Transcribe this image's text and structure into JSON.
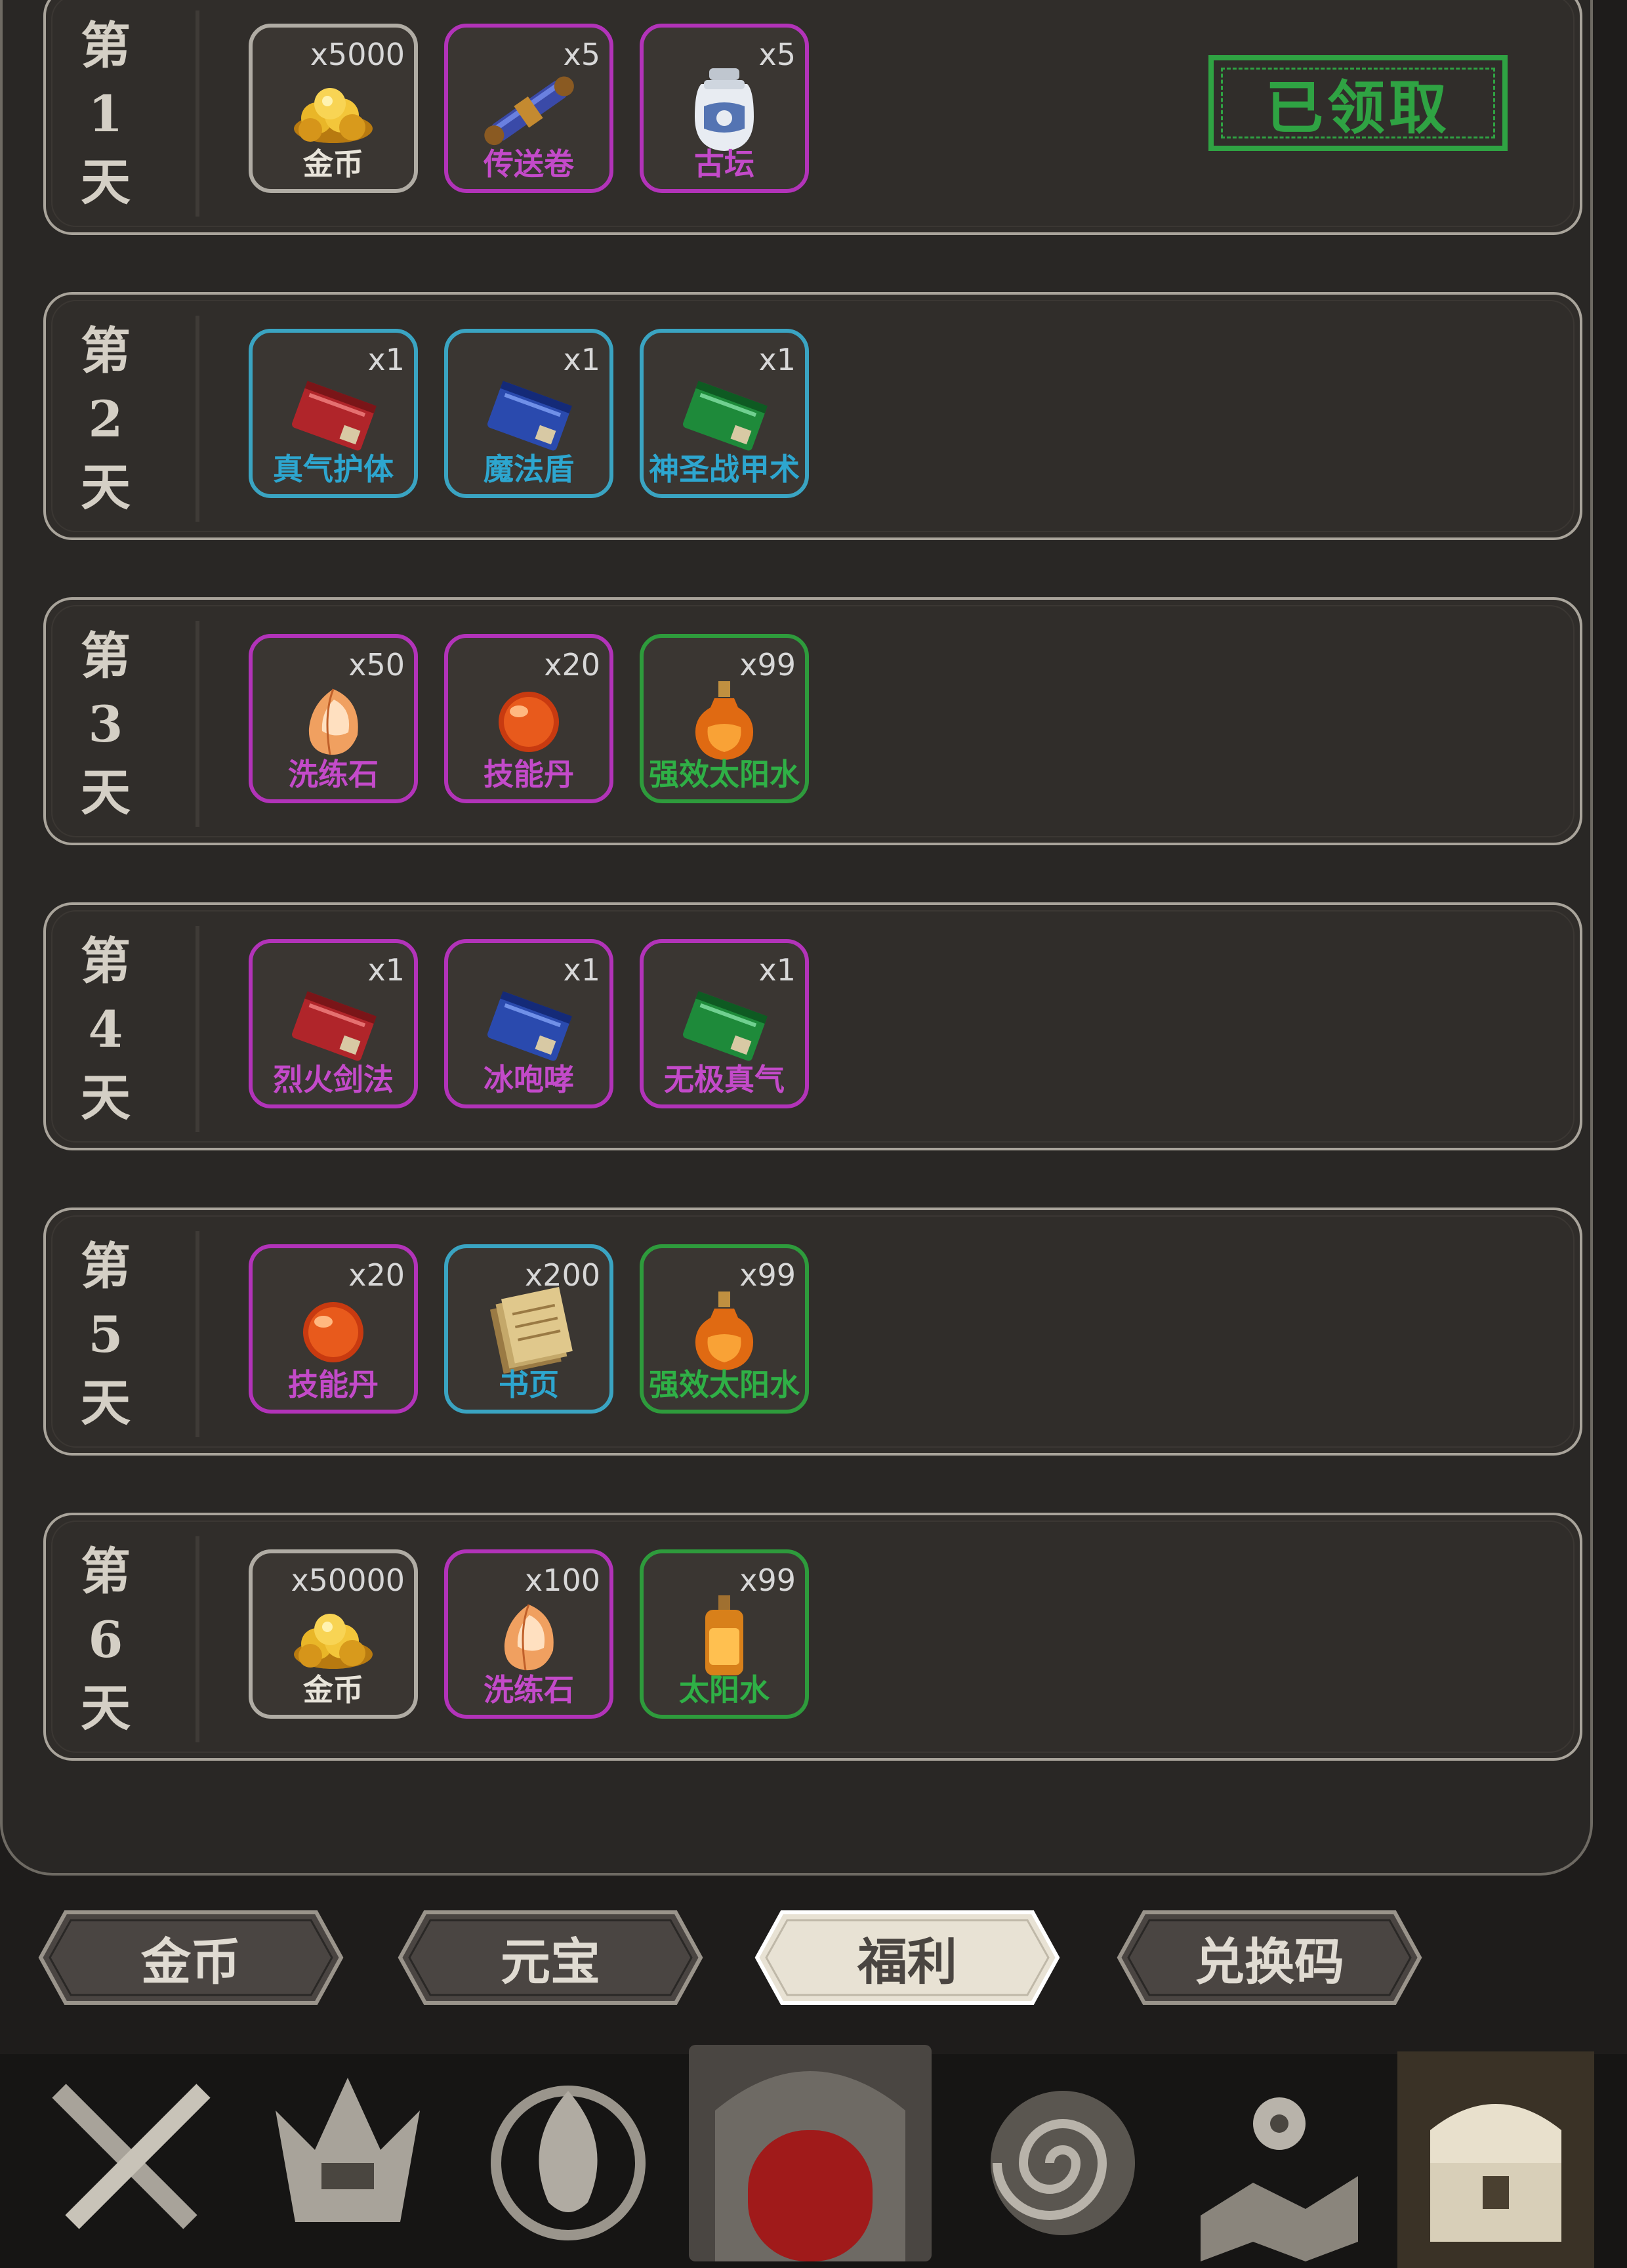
{
  "days": [
    {
      "label": [
        "第",
        "1",
        "天"
      ],
      "claimed_stamp": "已领取",
      "items": [
        {
          "count": "x5000",
          "name": "金币",
          "quality": "white",
          "icon": "gold-icon"
        },
        {
          "count": "x5",
          "name": "传送卷",
          "quality": "purple",
          "icon": "scroll-icon"
        },
        {
          "count": "x5",
          "name": "古坛",
          "quality": "purple",
          "icon": "jar-icon"
        }
      ]
    },
    {
      "label": [
        "第",
        "2",
        "天"
      ],
      "items": [
        {
          "count": "x1",
          "name": "真气护体",
          "quality": "blue",
          "icon": "red-book-icon"
        },
        {
          "count": "x1",
          "name": "魔法盾",
          "quality": "blue",
          "icon": "blue-book-icon"
        },
        {
          "count": "x1",
          "name": "神圣战甲术",
          "quality": "blue",
          "icon": "green-book-icon"
        }
      ]
    },
    {
      "label": [
        "第",
        "3",
        "天"
      ],
      "items": [
        {
          "count": "x50",
          "name": "洗练石",
          "quality": "purple",
          "icon": "stone-icon"
        },
        {
          "count": "x20",
          "name": "技能丹",
          "quality": "purple",
          "icon": "pill-icon"
        },
        {
          "count": "x99",
          "name": "强效太阳水",
          "quality": "green",
          "icon": "potion-icon"
        }
      ]
    },
    {
      "label": [
        "第",
        "4",
        "天"
      ],
      "items": [
        {
          "count": "x1",
          "name": "烈火剑法",
          "quality": "purple",
          "icon": "red-book-icon"
        },
        {
          "count": "x1",
          "name": "冰咆哮",
          "quality": "purple",
          "icon": "blue-book-icon"
        },
        {
          "count": "x1",
          "name": "无极真气",
          "quality": "purple",
          "icon": "green-book-icon"
        }
      ]
    },
    {
      "label": [
        "第",
        "5",
        "天"
      ],
      "items": [
        {
          "count": "x20",
          "name": "技能丹",
          "quality": "purple",
          "icon": "pill-icon"
        },
        {
          "count": "x200",
          "name": "书页",
          "quality": "blue",
          "icon": "pages-icon"
        },
        {
          "count": "x99",
          "name": "强效太阳水",
          "quality": "green",
          "icon": "potion-icon"
        }
      ]
    },
    {
      "label": [
        "第",
        "6",
        "天"
      ],
      "items": [
        {
          "count": "x50000",
          "name": "金币",
          "quality": "white",
          "icon": "gold-icon"
        },
        {
          "count": "x100",
          "name": "洗练石",
          "quality": "purple",
          "icon": "stone-icon"
        },
        {
          "count": "x99",
          "name": "太阳水",
          "quality": "green",
          "icon": "bottle-icon"
        }
      ]
    }
  ],
  "tabs": [
    {
      "label": "金币",
      "active": false
    },
    {
      "label": "元宝",
      "active": false
    },
    {
      "label": "福利",
      "active": true
    },
    {
      "label": "兑换码",
      "active": false
    }
  ],
  "bottom_nav": [
    "crossed-swords-icon",
    "crown-helmet-icon",
    "flame-emblem-icon",
    "portal-gate-icon",
    "spiral-icon",
    "map-pin-icon",
    "treasure-chest-icon"
  ],
  "colors": {
    "white": "#b0aca4",
    "purple": "#b233b9",
    "blue": "#3aa4c2",
    "green": "#2e9b3c",
    "stamp": "#2fa343"
  }
}
